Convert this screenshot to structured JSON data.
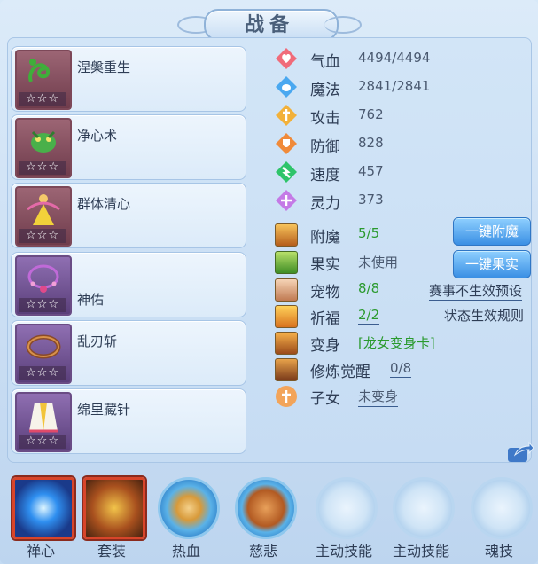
{
  "title": "战备",
  "skills": [
    {
      "name": "涅槃重生",
      "stars": "☆☆☆"
    },
    {
      "name": "净心术",
      "stars": "☆☆☆"
    },
    {
      "name": "群体清心",
      "stars": "☆☆☆"
    },
    {
      "name": "神佑",
      "stars": "☆☆☆"
    },
    {
      "name": "乱刃斩",
      "stars": "☆☆☆"
    },
    {
      "name": "绵里藏针",
      "stars": "☆☆☆"
    }
  ],
  "stats": [
    {
      "label": "气血",
      "value": "4494/4494",
      "icon": "heart-icon",
      "color": "#f06b7a"
    },
    {
      "label": "魔法",
      "value": "2841/2841",
      "icon": "mana-icon",
      "color": "#4aa8f0"
    },
    {
      "label": "攻击",
      "value": "762",
      "icon": "sword-icon",
      "color": "#f2b13a"
    },
    {
      "label": "防御",
      "value": "828",
      "icon": "shield-icon",
      "color": "#f08a3a"
    },
    {
      "label": "速度",
      "value": "457",
      "icon": "speed-icon",
      "color": "#2fc46a"
    },
    {
      "label": "灵力",
      "value": "373",
      "icon": "spirit-icon",
      "color": "#c47ae6"
    }
  ],
  "attrs": {
    "enchant": {
      "label": "附魔",
      "value": "5/5"
    },
    "fruit": {
      "label": "果实",
      "value": "未使用"
    },
    "pet": {
      "label": "宠物",
      "value": "8/8"
    },
    "blessing": {
      "label": "祈福",
      "value": "2/2"
    },
    "transform": {
      "label": "变身",
      "value": "[龙女变身卡]"
    },
    "awaken": {
      "label": "修炼觉醒",
      "value": "0/8"
    },
    "child": {
      "label": "子女",
      "value": "未变身"
    }
  },
  "buttons": {
    "enchant_all": "一键附魔",
    "fruit_all": "一键果实"
  },
  "links": {
    "preset": "赛事不生效预设",
    "rules": "状态生效规则"
  },
  "tabs": [
    {
      "label": "禅心"
    },
    {
      "label": "套装"
    },
    {
      "label": "热血"
    },
    {
      "label": "慈悲"
    },
    {
      "label": "主动技能"
    },
    {
      "label": "主动技能"
    },
    {
      "label": "魂技"
    }
  ]
}
